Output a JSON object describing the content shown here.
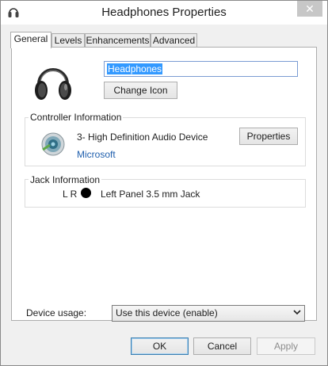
{
  "window": {
    "title": "Headphones Properties",
    "close_glyph": "✕"
  },
  "tabs": [
    {
      "label": "General",
      "active": true
    },
    {
      "label": "Levels",
      "active": false
    },
    {
      "label": "Enhancements",
      "active": false
    },
    {
      "label": "Advanced",
      "active": false
    }
  ],
  "general": {
    "icon": "headphones-icon",
    "device_name": "Headphones",
    "change_icon_label": "Change Icon"
  },
  "controller": {
    "group_label": "Controller Information",
    "icon": "speaker-device-icon",
    "device": "3- High Definition Audio Device",
    "properties_label": "Properties",
    "vendor": "Microsoft"
  },
  "jack": {
    "group_label": "Jack Information",
    "channels": "L R",
    "color": "#000000",
    "description": "Left Panel 3.5 mm Jack"
  },
  "device_usage": {
    "label": "Device usage:",
    "selected": "Use this device (enable)"
  },
  "footer": {
    "ok_label": "OK",
    "cancel_label": "Cancel",
    "apply_label": "Apply"
  }
}
